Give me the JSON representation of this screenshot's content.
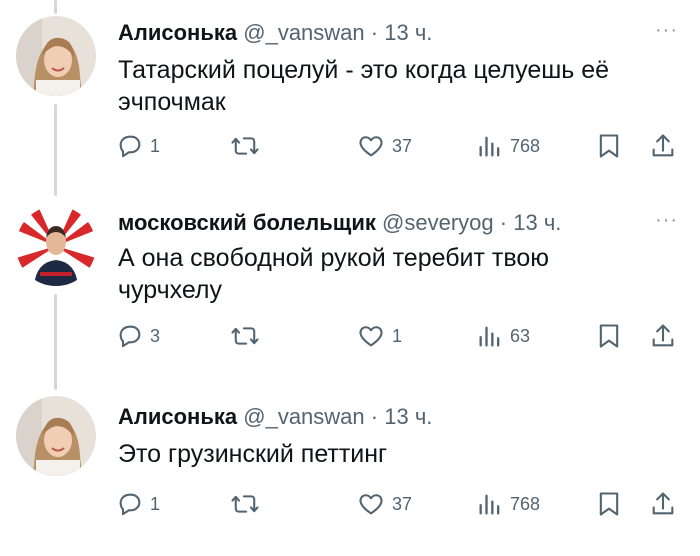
{
  "tweets": [
    {
      "name": "Алисонька",
      "handle": "@_vanswan",
      "sep": "·",
      "time": "13 ч.",
      "more": "···",
      "text_line1": "Татарский поцелуй - это когда целуешь её",
      "text_line2": "эчпочмак",
      "replies": "1",
      "retweets": "",
      "likes": "37",
      "views": "768"
    },
    {
      "name": "московский болельщик",
      "handle": "@severyog",
      "sep": "·",
      "time": "13 ч.",
      "more": "···",
      "text_line1": "А она свободной рукой теребит твою",
      "text_line2": "чурчхелу",
      "replies": "3",
      "retweets": "",
      "likes": "1",
      "views": "63"
    },
    {
      "name": "Алисонька",
      "handle": "@_vanswan",
      "sep": "·",
      "time": "13 ч.",
      "more": "",
      "text_line1": "Это грузинский петтинг",
      "text_line2": "",
      "replies": "1",
      "retweets": "",
      "likes": "37",
      "views": "768"
    }
  ],
  "icons": {
    "reply": "reply-icon",
    "retweet": "retweet-icon",
    "like": "heart-icon",
    "views": "views-icon",
    "bookmark": "bookmark-icon",
    "share": "share-icon"
  },
  "colors": {
    "text": "#0f1419",
    "muted": "#536471",
    "thread_line": "#cfd9de"
  }
}
